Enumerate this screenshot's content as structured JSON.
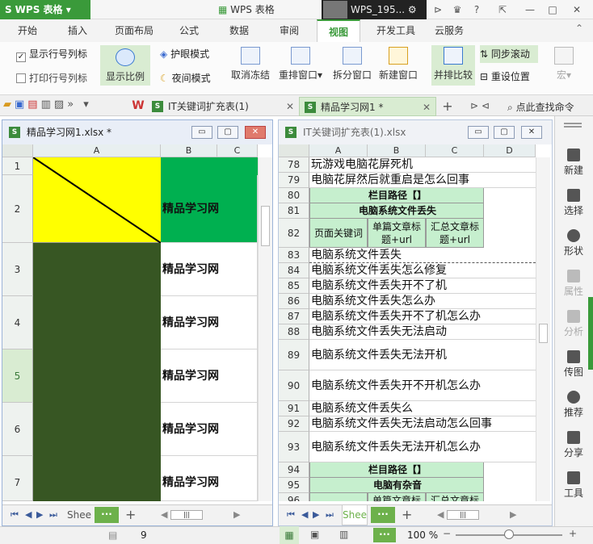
{
  "app": {
    "name": "WPS 表格",
    "window_title": "WPS 表格",
    "user": "WPS_195..."
  },
  "menu_tabs": [
    "开始",
    "插入",
    "页面布局",
    "公式",
    "数据",
    "审阅",
    "视图",
    "开发工具",
    "云服务"
  ],
  "active_menu_tab": "视图",
  "ribbon": {
    "show_row_col": "显示行号列标",
    "print_row_col": "打印行号列标",
    "zoom_ratio": "显示比例",
    "eye_mode": "护眼模式",
    "night_mode": "夜间模式",
    "unfreeze": "取消冻结",
    "rearrange": "重排窗口",
    "split": "拆分窗口",
    "new_window": "新建窗口",
    "side_by_side": "并排比较",
    "sync_scroll": "同步滚动",
    "reset_position": "重设位置",
    "macro": "宏"
  },
  "doc_tabs": [
    {
      "label": "IT关键词扩充表(1)",
      "active": false
    },
    {
      "label": "精品学习网1 *",
      "active": true
    }
  ],
  "find_command": "点此查找命令",
  "left_window": {
    "title": "精品学习网1.xlsx *",
    "columns": [
      "A",
      "B",
      "C"
    ],
    "rows": [
      {
        "num": "1",
        "b": ""
      },
      {
        "num": "2",
        "b": "精品学习网"
      },
      {
        "num": "3",
        "b": "精品学习网"
      },
      {
        "num": "4",
        "b": "精品学习网"
      },
      {
        "num": "5",
        "b": "精品学习网"
      },
      {
        "num": "6",
        "b": "精品学习网"
      },
      {
        "num": "7",
        "b": "精品学习网"
      }
    ],
    "sheet_tab": "Shee"
  },
  "right_window": {
    "title": "IT关键词扩充表(1).xlsx",
    "columns": [
      "A",
      "B",
      "C",
      "D"
    ],
    "rows": [
      {
        "num": "78",
        "text": "玩游戏电脑花屏死机"
      },
      {
        "num": "79",
        "text": "电脑花屏然后就重启是怎么回事"
      },
      {
        "num": "80",
        "text": "栏目路径【】"
      },
      {
        "num": "81",
        "text": "电脑系统文件丢失"
      },
      {
        "num": "82",
        "a": "页面关键词",
        "b1": "单篇文章标",
        "b2": "题+url",
        "c1": "汇总文章标",
        "c2": "题+url"
      },
      {
        "num": "83",
        "text": "电脑系统文件丢失"
      },
      {
        "num": "84",
        "text": "电脑系统文件丢失怎么修复"
      },
      {
        "num": "85",
        "text": "电脑系统文件丢失开不了机"
      },
      {
        "num": "86",
        "text": "电脑系统文件丢失怎么办"
      },
      {
        "num": "87",
        "text": "电脑系统文件丢失开不了机怎么办"
      },
      {
        "num": "88",
        "text": "电脑系统文件丢失无法启动"
      },
      {
        "num": "89",
        "text": "电脑系统文件丢失无法开机"
      },
      {
        "num": "90",
        "text": "电脑系统文件丢失开不开机怎么办"
      },
      {
        "num": "91",
        "text": "电脑系统文件丢失么"
      },
      {
        "num": "92",
        "text": "电脑系统文件丢失无法启动怎么回事"
      },
      {
        "num": "93",
        "text": "电脑系统文件丢失无法开机怎么办"
      },
      {
        "num": "94",
        "text": "栏目路径【】"
      },
      {
        "num": "95",
        "text": "电脑有杂音"
      },
      {
        "num": "96",
        "b1": "单篇文章标",
        "c1": "汇总文章标"
      }
    ],
    "sheet_tab": "Shee"
  },
  "right_panel": [
    "新建",
    "选择",
    "形状",
    "属性",
    "分析",
    "传图",
    "推荐",
    "分享",
    "工具"
  ],
  "status": {
    "count": "9",
    "zoom": "100 %"
  },
  "colors": {
    "brand_green": "#3a9a3a",
    "header_fill": "#c6efce",
    "yellow": "#ffff00",
    "green": "#00b050",
    "dark_green": "#375623"
  }
}
